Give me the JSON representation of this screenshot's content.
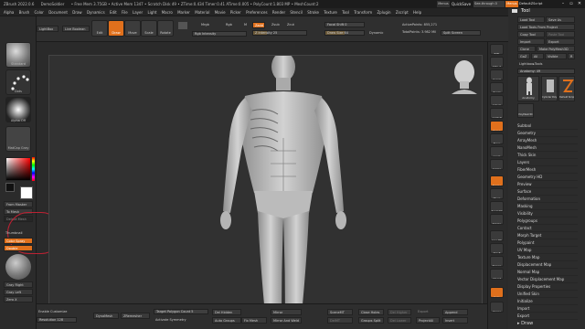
{
  "titlebar": {
    "items": [
      "ZBrush 2022.0.6",
      "DemoSoldier",
      "• Free Mem 3.75GB • Active Mem 1347 • Scratch Disk 49 • ZTime:0.434 Timer:0.41 ATime:0.005 • PolyCount:1.803 MP • MeshCount:2"
    ],
    "menus_label": "Menus",
    "quicksave": "QuickSave",
    "seethrough": "See-through 0",
    "defaultscript": "DefaultZScript"
  },
  "menubar": [
    "Alpha",
    "Brush",
    "Color",
    "Document",
    "Draw",
    "Dynamics",
    "Edit",
    "File",
    "Layer",
    "Light",
    "Macro",
    "Marker",
    "Material",
    "Movie",
    "Picker",
    "Preferences",
    "Render",
    "Stencil",
    "Stroke",
    "Texture",
    "Tool",
    "Transform",
    "Zplugin",
    "Zscript",
    "Help"
  ],
  "top": {
    "homepage": "Home Page",
    "lightbox": "LightBox",
    "liveboolean": "Live Boolean",
    "tools": [
      "Edit",
      "Draw",
      "Move",
      "Scale",
      "Rotate"
    ],
    "mrgb": "Mrgb",
    "rgb": "Rgb",
    "m": "M",
    "zadd": "Zadd",
    "zsub": "Zsub",
    "zcut": "Zcut",
    "rgb_intensity": "Rgb Intensity",
    "z_intensity": "Z Intensity 25",
    "focal_shift": "Focal Shift 0",
    "draw_size": "Draw Size 64",
    "dynamic": "Dynamic",
    "active_points": "ActivePoints: 855,271",
    "total_points": "TotalPoints: 3.982 Mil",
    "split_screen": "Split Screen"
  },
  "left": {
    "brush_label": "Standard",
    "stroke_label": "Dots",
    "alpha_label": "Alpha Off",
    "texture_label": "Texture Off",
    "material_label": "MatCap Gray",
    "gradient": "Gradient",
    "switch_color": "SwitchColor",
    "alternate": "Alternate",
    "from_masker": "From Masker",
    "to_mesh": "To Mesh",
    "delete_mesh": "Delete Mesh",
    "thumbnail": "Thumbnail",
    "color_spray": "Color Spray",
    "double": "Double",
    "gray_right": "Gray Right",
    "gray_left": "Gray Left",
    "zero_x": "Zero X"
  },
  "right_shelf": [
    "BPR",
    "SPix 3",
    "Scroll",
    "Zoom",
    "Actual",
    "AAHalf",
    "Persp",
    "Floor",
    "Local",
    "Gizmo",
    "Frame",
    "Move",
    "Zoom3D",
    "Rotate",
    "Line Fill",
    "PolyF",
    "Transp",
    "Ghost",
    "Solo",
    "Xpose"
  ],
  "tool_panel": {
    "title": "Tool",
    "load_tool": "Load Tool",
    "save_as": "Save As",
    "load_from_project": "Load Tools From Project",
    "copy_tool": "Copy Tool",
    "paste_tool": "Paste Tool",
    "import": "Import",
    "export": "Export",
    "clone": "Clone",
    "make_polymesh": "Make PolyMesh3D",
    "goz": "GoZ",
    "all": "All",
    "visible": "Visible",
    "r": "R",
    "lightbox_tools": "Lightbox▸Tools",
    "anatomy_value": "Anatomy: 49",
    "thumb_labels": [
      "Anatomy",
      "Cylinder PolyMesh",
      "Default Simple Brush",
      "PolyMesh3D"
    ],
    "subpanels": [
      "Subtool",
      "Geometry",
      "ArrayMesh",
      "NanoMesh",
      "Thick Skin",
      "Layers",
      "FiberMesh",
      "Geometry HD",
      "Preview",
      "Surface",
      "Deformation",
      "Masking",
      "Visibility",
      "Polygroups",
      "Contact",
      "Morph Target",
      "Polypaint",
      "UV Map",
      "Texture Map",
      "Displacement Map",
      "Normal Map",
      "Vector Displacement Map",
      "Display Properties",
      "Unified Skin",
      "Initialize",
      "Import",
      "Export"
    ]
  },
  "bottom": {
    "enable_customize": "Enable Customize",
    "resolution": "Resolution 128",
    "dynamesh": "DynaMesh",
    "zremesher": "ZRemesher",
    "target_polycount": "Target Polygon Count 5",
    "activate_symmetry": "Activate Symmetry",
    "del_hidden": "Del Hidden",
    "auto_groups": "Auto Groups",
    "fix_mesh": "Fix Mesh",
    "mirror": "Mirror",
    "mirror_and_weld": "Mirror And Weld",
    "scene_mt": "SceneMT",
    "del_mt": "DelMT",
    "close_holes": "Close Holes",
    "groups_split": "Groups Split",
    "del_higher": "Del Higher",
    "del_lower": "Del Lower",
    "project_all": "ProjectAll",
    "split_screen": "Split Screen",
    "append": "Append",
    "insert": "Insert"
  },
  "colors": {
    "accent": "#e0701c",
    "panel": "#2c2c2c",
    "canvas": "#313131",
    "figure": "#bdbdbd"
  }
}
